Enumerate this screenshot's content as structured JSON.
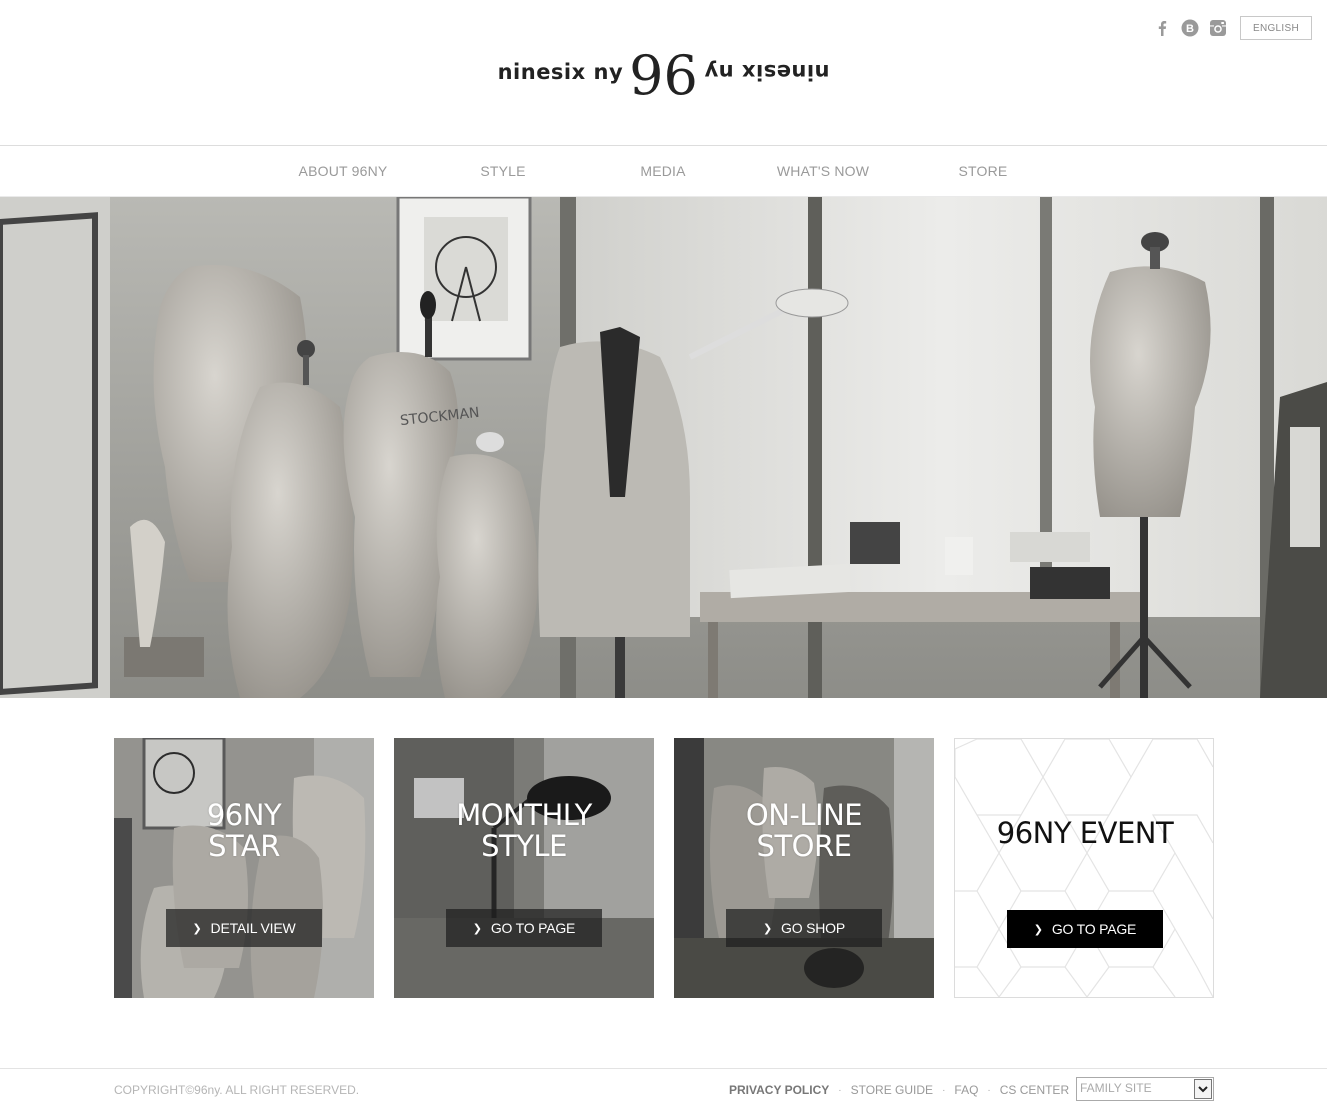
{
  "header": {
    "social": [
      "facebook-icon",
      "blog-icon",
      "instagram-icon"
    ],
    "language_label": "ENGLISH",
    "logo": {
      "left": "ninesix ny",
      "number": "96",
      "right": "ninesix ny"
    }
  },
  "nav": {
    "items": [
      {
        "label": "ABOUT 96NY"
      },
      {
        "label": "STYLE"
      },
      {
        "label": "MEDIA"
      },
      {
        "label": "WHAT'S NOW"
      },
      {
        "label": "STORE"
      }
    ]
  },
  "hero": {
    "image": "atelier-mannequins-photo",
    "dummy_text": "STOCKMAN"
  },
  "cards": [
    {
      "title_line1": "96NY",
      "title_line2": "STAR",
      "button": "DETAIL VIEW"
    },
    {
      "title_line1": "MONTHLY",
      "title_line2": "STYLE",
      "button": "GO TO PAGE"
    },
    {
      "title_line1": "ON-LINE",
      "title_line2": "STORE",
      "button": "GO SHOP"
    },
    {
      "title_line1": "96NY EVENT",
      "title_line2": "",
      "button": "GO TO PAGE"
    }
  ],
  "footer": {
    "copyright": "COPYRIGHT©96ny. ALL RIGHT RESERVED.",
    "links": [
      "PRIVACY POLICY",
      "STORE GUIDE",
      "FAQ",
      "CS CENTER"
    ],
    "family_site": "FAMILY SITE"
  },
  "colors": {
    "text_dark": "#222222",
    "nav_text": "#9a9a9a",
    "button_dark": "#1e1e1e",
    "footer_text": "#999999"
  }
}
